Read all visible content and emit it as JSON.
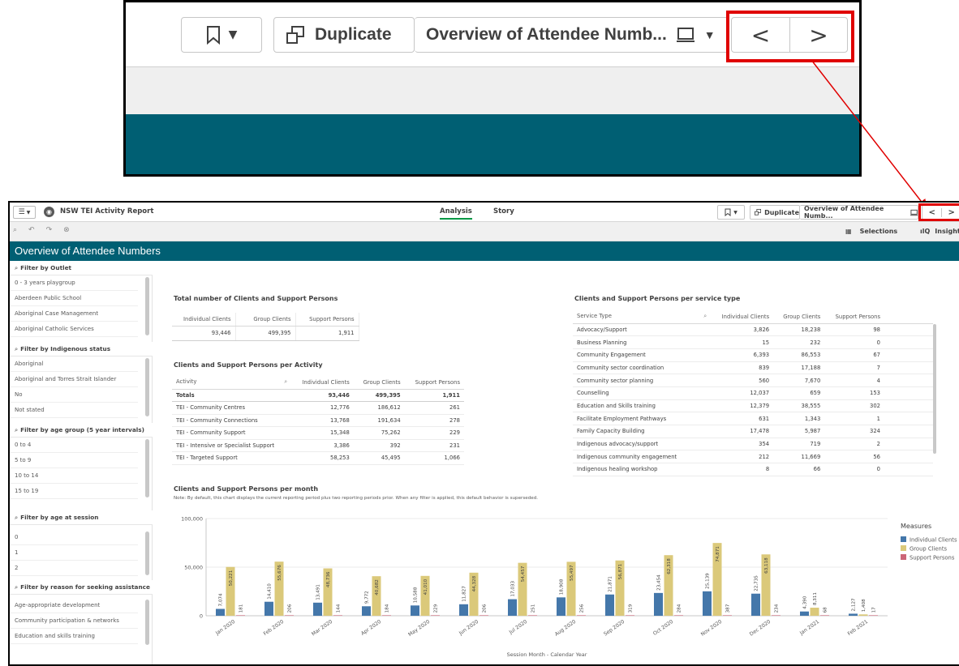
{
  "app": {
    "title": "NSW TEI Activity Report",
    "tabs": [
      {
        "label": "Analysis"
      },
      {
        "label": "Story"
      }
    ],
    "duplicate_label": "Duplicate",
    "sheet_label": "Overview of Attendee Numb...",
    "sheet_label_zoom": "Overview of Attendee Numb...",
    "selections_label": "Selections",
    "insights_label": "Insights",
    "sheet_title": "Overview of Attendee Numbers",
    "prev_glyph": "<",
    "next_glyph": ">"
  },
  "filters": [
    {
      "title": "Filter by Outlet",
      "items": [
        "0 - 3 years playgroup",
        "Aberdeen Public School",
        "Aboriginal Case Management",
        "Aboriginal Catholic Services"
      ]
    },
    {
      "title": "Filter by Indigenous status",
      "items": [
        "Aboriginal",
        "Aboriginal and Torres Strait Islander",
        "No",
        "Not stated"
      ]
    },
    {
      "title": "Filter by age group (5 year intervals)",
      "items": [
        "0 to 4",
        "5 to 9",
        "10 to 14",
        "15 to 19"
      ]
    },
    {
      "title": "Filter by age at session",
      "items": [
        "0",
        "1",
        "2"
      ]
    },
    {
      "title": "Filter by reason for seeking assistance",
      "items": [
        "Age-appropriate development",
        "Community participation & networks",
        "Education and skills training"
      ]
    }
  ],
  "totals_table": {
    "title": "Total number of Clients and Support Persons",
    "headers": [
      "Individual Clients",
      "Group Clients",
      "Support Persons"
    ],
    "values": [
      "93,446",
      "499,395",
      "1,911"
    ]
  },
  "activity_table": {
    "title": "Clients and Support Persons per Activity",
    "headers": [
      "Activity",
      "Individual Clients",
      "Group Clients",
      "Support Persons"
    ],
    "totals": [
      "Totals",
      "93,446",
      "499,395",
      "1,911"
    ],
    "rows": [
      [
        "TEI - Community Centres",
        "12,776",
        "186,612",
        "261"
      ],
      [
        "TEI - Community Connections",
        "13,768",
        "191,634",
        "278"
      ],
      [
        "TEI - Community Support",
        "15,348",
        "75,262",
        "229"
      ],
      [
        "TEI - Intensive or Specialist Support",
        "3,386",
        "392",
        "231"
      ],
      [
        "TEI - Targeted Support",
        "58,253",
        "45,495",
        "1,066"
      ]
    ]
  },
  "service_table": {
    "title": "Clients and Support Persons per service type",
    "headers": [
      "Service Type",
      "Individual Clients",
      "Group Clients",
      "Support Persons"
    ],
    "rows": [
      [
        "Advocacy/Support",
        "3,826",
        "18,238",
        "98"
      ],
      [
        "Business Planning",
        "15",
        "232",
        "0"
      ],
      [
        "Community Engagement",
        "6,393",
        "86,553",
        "67"
      ],
      [
        "Community sector coordination",
        "839",
        "17,188",
        "7"
      ],
      [
        "Community sector planning",
        "560",
        "7,670",
        "4"
      ],
      [
        "Counselling",
        "12,037",
        "659",
        "153"
      ],
      [
        "Education and Skills training",
        "12,379",
        "38,555",
        "302"
      ],
      [
        "Facilitate Employment Pathways",
        "631",
        "1,343",
        "1"
      ],
      [
        "Family Capacity Building",
        "17,478",
        "5,987",
        "324"
      ],
      [
        "Indigenous advocacy/support",
        "354",
        "719",
        "2"
      ],
      [
        "Indigenous community engagement",
        "212",
        "11,669",
        "56"
      ],
      [
        "Indigenous healing workshop",
        "8",
        "66",
        "0"
      ]
    ]
  },
  "chart_data": {
    "type": "bar",
    "title": "Clients and Support Persons per month",
    "subtitle": "Note: By default, this chart displays the current reporting period plus two reporting periods prior. When any filter is applied, this default behavior is superseded.",
    "xlabel": "Session Month - Calendar Year",
    "ylabel": "",
    "ylim": [
      0,
      100000
    ],
    "yticks": [
      0,
      50000,
      100000
    ],
    "ytick_labels": [
      "0",
      "50,000",
      "100,000"
    ],
    "legend_title": "Measures",
    "legend_position": "right",
    "categories": [
      "Jan 2020",
      "Feb 2020",
      "Mar 2020",
      "Apr 2020",
      "May 2020",
      "Jun 2020",
      "Jul 2020",
      "Aug 2020",
      "Sep 2020",
      "Oct 2020",
      "Nov 2020",
      "Dec 2020",
      "Jan 2021",
      "Feb 2021"
    ],
    "series": [
      {
        "name": "Individual Clients",
        "color": "#4477aa",
        "values": [
          7074,
          14410,
          13491,
          9772,
          10588,
          11827,
          17033,
          18908,
          21871,
          23454,
          25139,
          22735,
          4390,
          2127
        ],
        "labels": [
          "7,074",
          "14,410",
          "13,491",
          "9,772",
          "10,588",
          "11,827",
          "17,033",
          "18,908",
          "21,871",
          "23,454",
          "25,139",
          "22,735",
          "4,390",
          "2,127"
        ]
      },
      {
        "name": "Group Clients",
        "color": "#dbc97a",
        "values": [
          50221,
          55676,
          48736,
          40682,
          41010,
          44328,
          54457,
          55497,
          56871,
          62318,
          74871,
          63118,
          8311,
          1408
        ],
        "labels": [
          "50,221",
          "55,676",
          "48,736",
          "40,682",
          "41,010",
          "44,328",
          "54,457",
          "55,497",
          "56,871",
          "62,318",
          "74,871",
          "63,118",
          "8,311",
          "1,408"
        ]
      },
      {
        "name": "Support Persons",
        "color": "#cc6677",
        "values": [
          181,
          206,
          144,
          184,
          229,
          206,
          251,
          256,
          319,
          284,
          387,
          234,
          68,
          17
        ],
        "labels": [
          "181",
          "206",
          "144",
          "184",
          "229",
          "206",
          "251",
          "256",
          "319",
          "284",
          "387",
          "234",
          "68",
          "17"
        ]
      }
    ]
  }
}
